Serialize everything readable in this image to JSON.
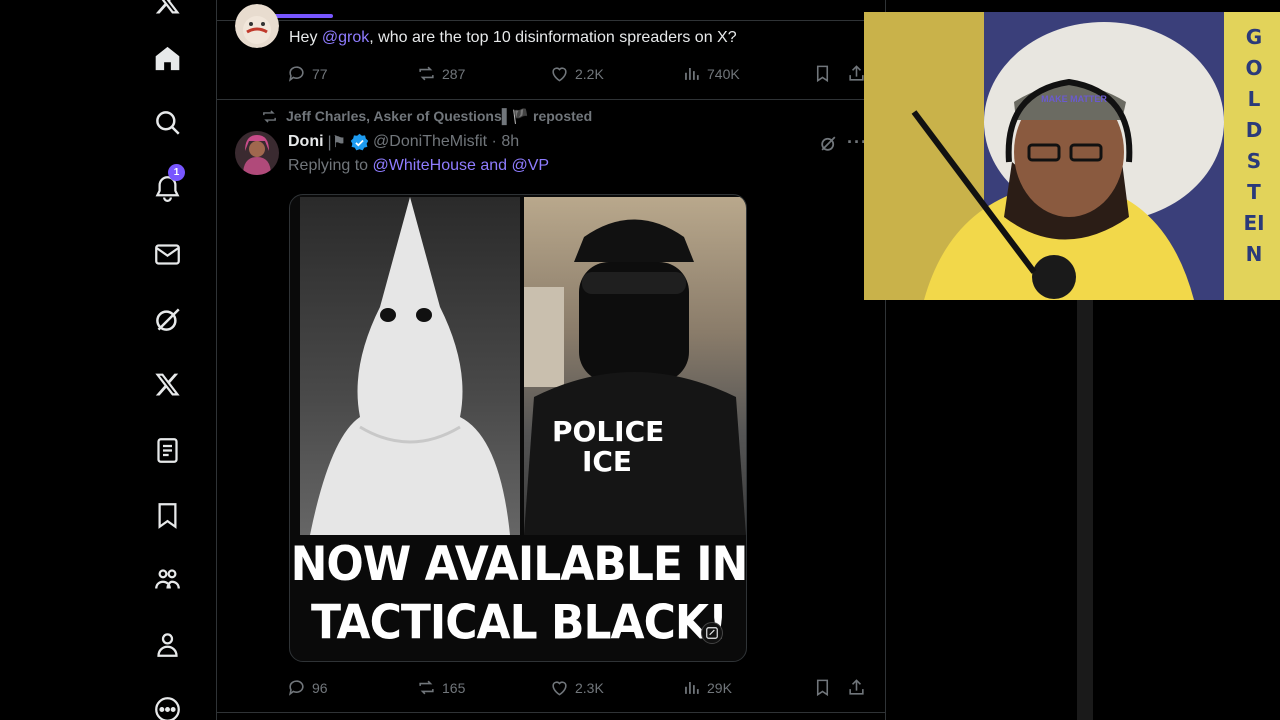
{
  "nav": {
    "notification_count": "1"
  },
  "tweet1": {
    "text_before": "Hey ",
    "mention": "@grok",
    "text_after": ", who are the top 10 disinformation spreaders on X?",
    "stats": {
      "replies": "77",
      "reposts": "287",
      "likes": "2.2K",
      "views": "740K"
    }
  },
  "tweet2": {
    "repost_by": "Jeff Charles, Asker of Questions▌🏴 reposted",
    "author_name": "Doni",
    "handle": "@DoniTheMisfit · 8h",
    "replying_label": "Replying to ",
    "replying_to": "@WhiteHouse and @VP",
    "media": {
      "patch_text": "POLICE\nICE",
      "caption_line1": "NOW AVAILABLE IN",
      "caption_line2": "TACTICAL BLACK!"
    },
    "stats": {
      "replies": "96",
      "reposts": "165",
      "likes": "2.3K",
      "views": "29K"
    }
  },
  "webcam": {
    "banner_text": "GOLDSTEIN",
    "cap_text": "MAKE MATTER"
  },
  "colors": {
    "accent": "#7856ff",
    "mention": "#8f7cff",
    "muted": "#71767b",
    "verified": "#1d9bf0"
  }
}
